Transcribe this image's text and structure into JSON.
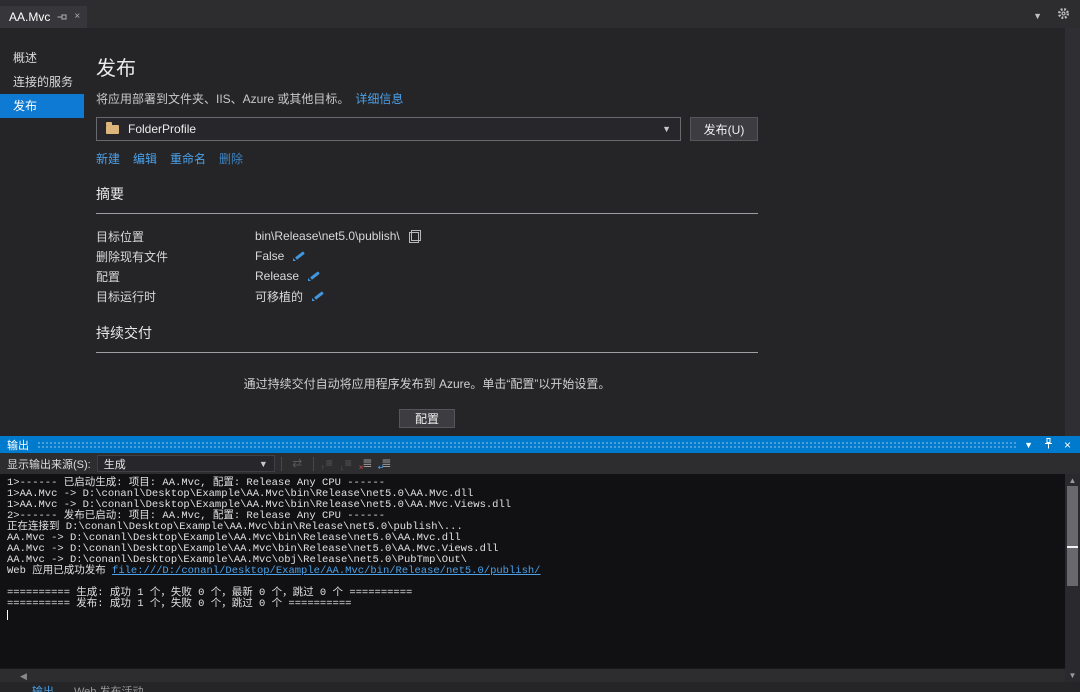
{
  "colors": {
    "accent_titlebar": "#007acc",
    "sidebar_selected": "#0e7ad3",
    "link_blue": "#4ba0e8",
    "folder_icon": "#dcb67a",
    "edit_icon": "#4097e0",
    "clear_badge_red": "#d84b4b"
  },
  "window": {
    "tab_label": "AA.Mvc"
  },
  "sidebar": {
    "items": [
      {
        "id": "overview",
        "label": "概述",
        "selected": false
      },
      {
        "id": "connected-services",
        "label": "连接的服务",
        "selected": false
      },
      {
        "id": "publish",
        "label": "发布",
        "selected": true
      }
    ]
  },
  "publish": {
    "title": "发布",
    "subtitle": "将应用部署到文件夹、IIS、Azure 或其他目标。",
    "details_link": "详细信息",
    "profile_name": "FolderProfile",
    "publish_button": "发布(U)",
    "actions": [
      {
        "id": "new",
        "label": "新建",
        "dim": false
      },
      {
        "id": "edit",
        "label": "编辑",
        "dim": false
      },
      {
        "id": "rename",
        "label": "重命名",
        "dim": false
      },
      {
        "id": "delete",
        "label": "删除",
        "dim": true
      }
    ],
    "summary": {
      "heading": "摘要",
      "rows": [
        {
          "id": "target-location",
          "label": "目标位置",
          "value": "bin\\Release\\net5.0\\publish\\",
          "icon": "copy"
        },
        {
          "id": "delete-existing-files",
          "label": "删除现有文件",
          "value": "False",
          "icon": "edit"
        },
        {
          "id": "configuration",
          "label": "配置",
          "value": "Release",
          "icon": "edit"
        },
        {
          "id": "target-runtime",
          "label": "目标运行时",
          "value": "可移植的",
          "icon": "edit"
        }
      ]
    },
    "continuous_delivery": {
      "heading": "持续交付",
      "description": "通过持续交付自动将应用程序发布到 Azure。单击“配置”以开始设置。",
      "configure_button": "配置"
    }
  },
  "output_panel": {
    "title": "输出",
    "source_label": "显示输出来源(S):",
    "source_value": "生成",
    "toolbar_icons": [
      {
        "name": "find-message-in-code-icon",
        "glyph": "⇄",
        "dim": true
      },
      {
        "name": "goto-previous-message-icon",
        "glyph": "≡",
        "badge": "↑",
        "badge_color": "#9a9a9a",
        "dim": true
      },
      {
        "name": "goto-next-message-icon",
        "glyph": "≡",
        "badge": "↓",
        "badge_color": "#9a9a9a",
        "dim": true
      },
      {
        "name": "clear-all-icon",
        "glyph": "≣",
        "badge": "×",
        "badge_color": "#d84b4b",
        "dim": false
      },
      {
        "name": "toggle-word-wrap-icon",
        "glyph": "≣",
        "badge": "↵",
        "badge_color": "#4ba0e8",
        "dim": false
      }
    ],
    "log": [
      {
        "text": "1>------ 已启动生成: 项目: AA.Mvc, 配置: Release Any CPU ------"
      },
      {
        "text": "1>AA.Mvc -> D:\\conanl\\Desktop\\Example\\AA.Mvc\\bin\\Release\\net5.0\\AA.Mvc.dll"
      },
      {
        "text": "1>AA.Mvc -> D:\\conanl\\Desktop\\Example\\AA.Mvc\\bin\\Release\\net5.0\\AA.Mvc.Views.dll"
      },
      {
        "text": "2>------ 发布已启动: 项目: AA.Mvc, 配置: Release Any CPU ------"
      },
      {
        "text": "正在连接到 D:\\conanl\\Desktop\\Example\\AA.Mvc\\bin\\Release\\net5.0\\publish\\..."
      },
      {
        "text": "AA.Mvc -> D:\\conanl\\Desktop\\Example\\AA.Mvc\\bin\\Release\\net5.0\\AA.Mvc.dll"
      },
      {
        "text": "AA.Mvc -> D:\\conanl\\Desktop\\Example\\AA.Mvc\\bin\\Release\\net5.0\\AA.Mvc.Views.dll"
      },
      {
        "text": "AA.Mvc -> D:\\conanl\\Desktop\\Example\\AA.Mvc\\obj\\Release\\net5.0\\PubTmp\\Out\\"
      },
      {
        "prefix": "Web 应用已成功发布 ",
        "link": "file:///D:/conanl/Desktop/Example/AA.Mvc/bin/Release/net5.0/publish/"
      },
      {
        "blank": true
      },
      {
        "text": "========== 生成: 成功 1 个，失败 0 个，最新 0 个，跳过 0 个 =========="
      },
      {
        "text": "========== 发布: 成功 1 个，失败 0 个，跳过 0 个 =========="
      }
    ]
  },
  "bottom_tabs": [
    {
      "id": "output",
      "label": "输出",
      "active": true
    },
    {
      "id": "web-publish-activity",
      "label": "Web 发布活动",
      "active": false
    }
  ]
}
